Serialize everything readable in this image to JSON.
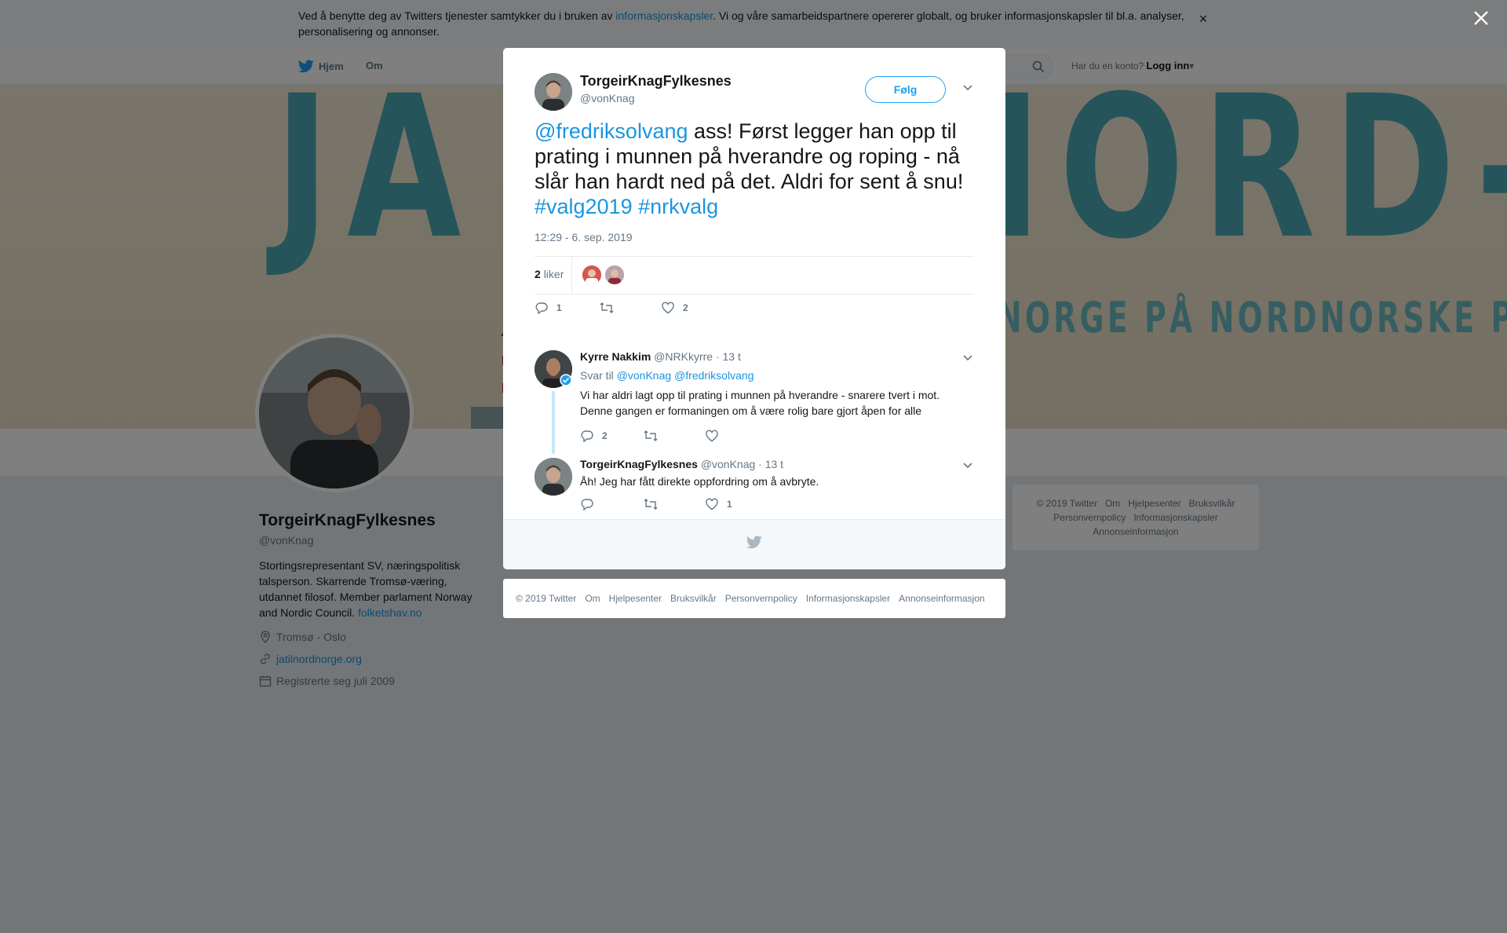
{
  "cookie": {
    "text_before": "Ved å benytte deg av Twitters tjenester samtykker du i bruken av ",
    "link": "informasjonskapsler",
    "text_after": ". Vi og våre samarbeidspartnere opererer globalt, og bruker informasjonskapsler til bl.a. analyser, personalisering og annonser.",
    "close": "×"
  },
  "nav": {
    "home": "Hjem",
    "about": "Om",
    "account_prompt": "Har du en konto?",
    "login": "Logg inn"
  },
  "banner": {
    "headline": "JA TIL NORD-NORGE",
    "subline": "NORGE PÅ NORDNORSKE PREMISSER"
  },
  "profile": {
    "name": "TorgeirKnagFylkesnes",
    "handle": "@vonKnag",
    "bio": "Stortingsrepresentant SV, næringspolitisk talsperson. Skarrende Tromsø-væring, utdannet filosof. Member parlament Norway and Nordic Council.",
    "bio_link": "folketshav.no",
    "location": "Tromsø - Oslo",
    "website": "jatilnordnorge.org",
    "joined": "Registrerte seg juli 2009"
  },
  "side_footer": {
    "items": [
      "© 2019 Twitter",
      "Om",
      "Hjelpesenter",
      "Bruksvilkår",
      "Personvernpolicy",
      "Informasjonskapsler",
      "Annonseinformasjon"
    ]
  },
  "tweet": {
    "name": "TorgeirKnagFylkesnes",
    "handle": "@vonKnag",
    "follow": "Følg",
    "mention": "@fredriksolvang",
    "text": " ass! Først legger han opp til prating i munnen på hverandre og roping - nå slår han hardt ned på det. Aldri for sent å snu! ",
    "hashtag1": "#valg2019",
    "hashtag2": "#nrkvalg",
    "time": "12:29 - 6. sep. 2019",
    "likes_count": "2",
    "likes_label": "liker",
    "reply_count": "1",
    "retweet_count": "",
    "like_count": "2"
  },
  "replies": [
    {
      "name": "Kyrre Nakkim",
      "handle": "@NRKkyrre",
      "time": "· 13 t",
      "reply_to_label": "Svar til",
      "reply_to_1": "@vonKnag",
      "reply_to_2": "@fredriksolvang",
      "text": "Vi har aldri lagt opp til prating i munnen på hverandre - snarere tvert i mot. Denne gangen er formaningen om å være rolig bare gjort åpen for alle",
      "reply_count": "2",
      "retweet_count": "",
      "like_count": ""
    },
    {
      "name": "TorgeirKnagFylkesnes",
      "handle": "@vonKnag",
      "time": "· 13 t",
      "text": "Åh! Jeg har fått direkte oppfordring om å avbryte.",
      "reply_count": "",
      "retweet_count": "",
      "like_count": "1"
    }
  ],
  "modal_footer": {
    "items": [
      "© 2019 Twitter",
      "Om",
      "Hjelpesenter",
      "Bruksvilkår",
      "Personvernpolicy",
      "Informasjonskapsler",
      "Annonseinformasjon"
    ]
  },
  "colors": {
    "accent": "#1da1f2",
    "link": "#1b95e0",
    "muted": "#657786",
    "banner_teal": "#4da8b6"
  }
}
